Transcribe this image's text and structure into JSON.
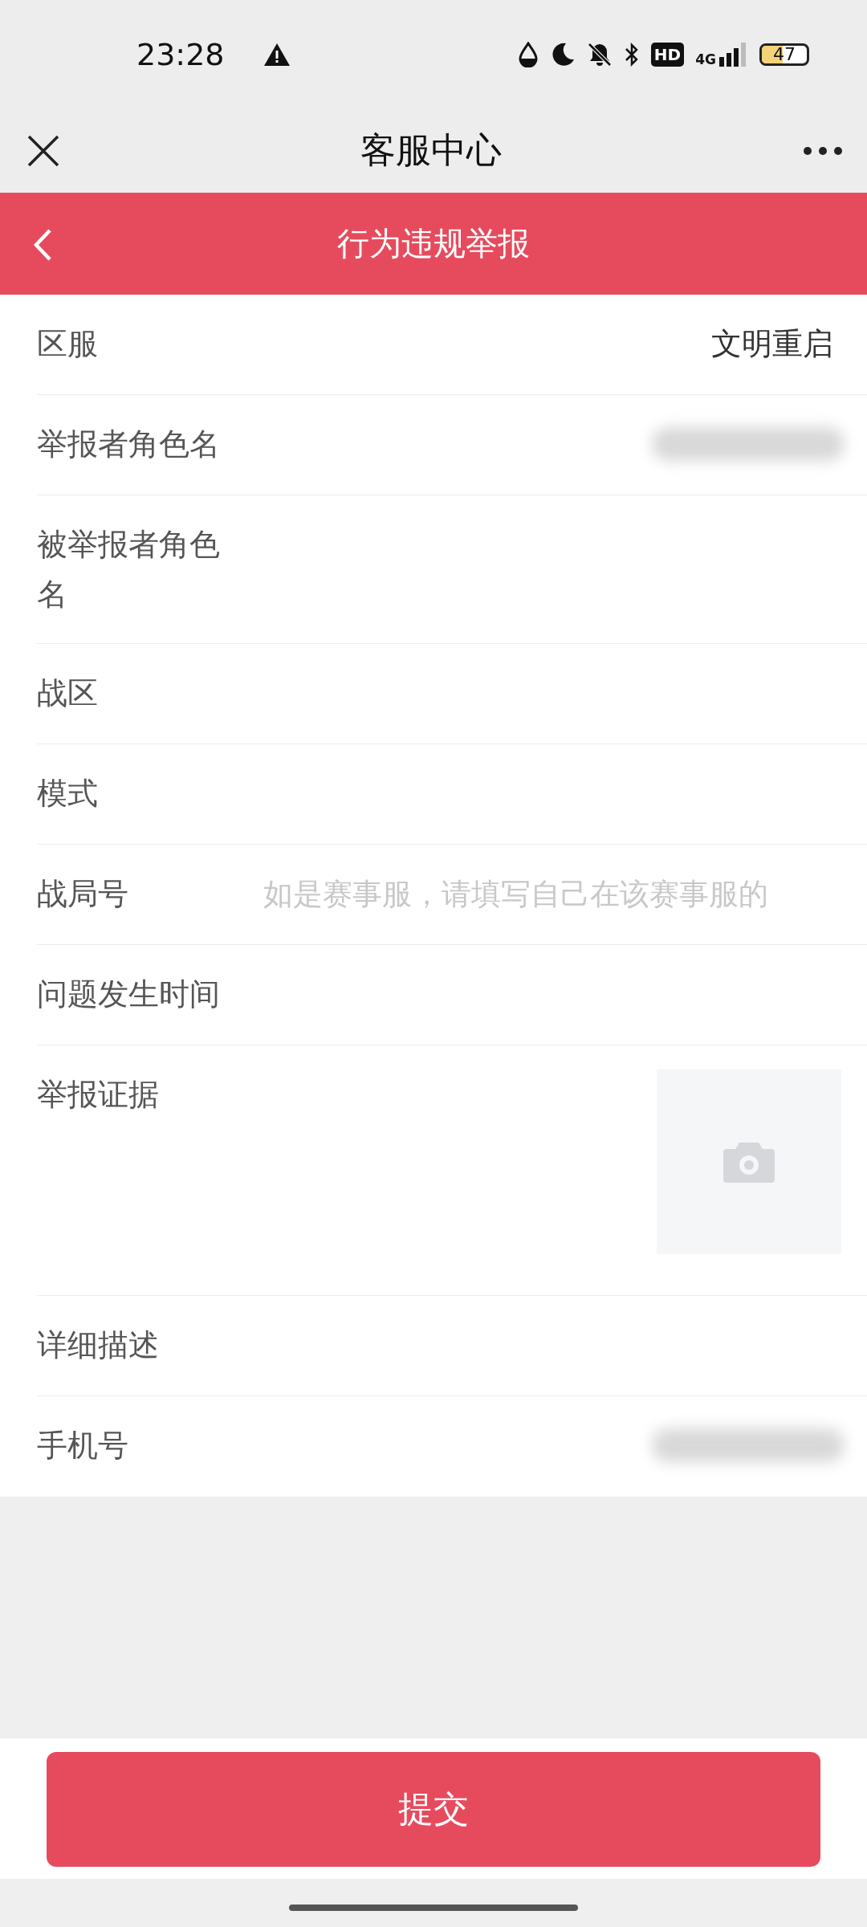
{
  "status_bar": {
    "time": "23:28",
    "hd": "HD",
    "network": "4G",
    "battery": "47"
  },
  "title_bar": {
    "title": "客服中心"
  },
  "header": {
    "title": "行为违规举报"
  },
  "fields": [
    {
      "kind": "value",
      "label": "区服",
      "value": "文明重启"
    },
    {
      "kind": "redacted",
      "label": "举报者角色名"
    },
    {
      "kind": "empty",
      "label": "被举报者角色名"
    },
    {
      "kind": "empty",
      "label": "战区"
    },
    {
      "kind": "empty",
      "label": "模式"
    },
    {
      "kind": "input",
      "label": "战局号",
      "placeholder": "如是赛事服，请填写自己在该赛事服的"
    },
    {
      "kind": "empty",
      "label": "问题发生时间"
    },
    {
      "kind": "photo",
      "label": "举报证据"
    },
    {
      "kind": "empty",
      "label": "详细描述"
    },
    {
      "kind": "redacted",
      "label": "手机号"
    }
  ],
  "submit": {
    "label": "提交"
  }
}
